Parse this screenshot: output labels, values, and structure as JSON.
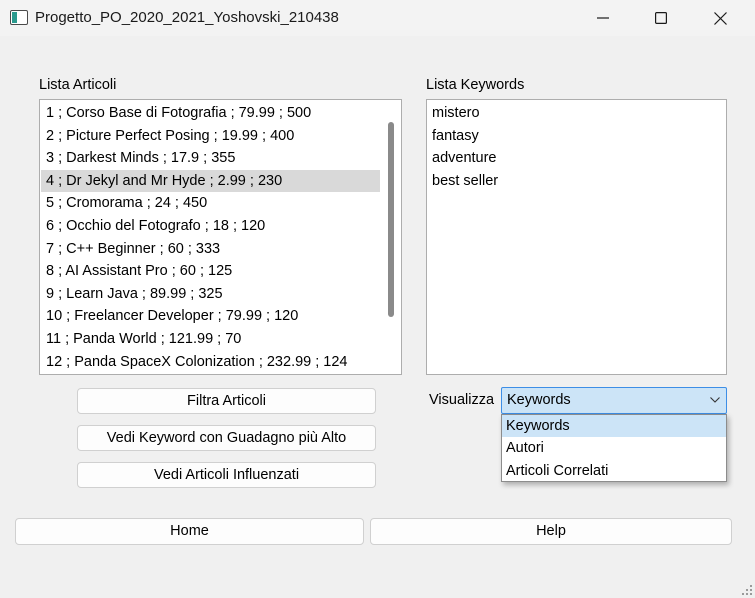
{
  "window": {
    "title": "Progetto_PO_2020_2021_Yoshovski_210438"
  },
  "articles": {
    "label": "Lista Articoli",
    "items": [
      "1 ; Corso Base di Fotografia ; 79.99 ; 500",
      "2 ; Picture Perfect Posing ; 19.99 ; 400",
      "3 ; Darkest Minds ; 17.9 ; 355",
      "4 ; Dr Jekyl and Mr Hyde ; 2.99 ; 230",
      "5 ; Cromorama ; 24 ; 450",
      "6 ; Occhio del Fotografo ; 18 ; 120",
      "7 ; C++ Beginner ; 60 ; 333",
      "8 ; AI Assistant Pro ; 60 ; 125",
      "9 ; Learn Java ; 89.99 ; 325",
      "10 ; Freelancer Developer ; 79.99 ; 120",
      "11 ; Panda World ; 121.99 ; 70",
      "12 ; Panda SpaceX Colonization ; 232.99 ; 124"
    ],
    "selected_index": 3
  },
  "keywords": {
    "label": "Lista Keywords",
    "items": [
      "mistero",
      "fantasy",
      "adventure",
      "best seller"
    ]
  },
  "buttons": {
    "filter": "Filtra Articoli",
    "top_keyword": "Vedi Keyword con Guadagno più Alto",
    "influenced": "Vedi Articoli Influenzati",
    "home": "Home",
    "help": "Help"
  },
  "view_select": {
    "label": "Visualizza",
    "selected": "Keywords",
    "options": [
      "Keywords",
      "Autori",
      "Articoli Correlati"
    ],
    "highlighted_index": 0
  }
}
